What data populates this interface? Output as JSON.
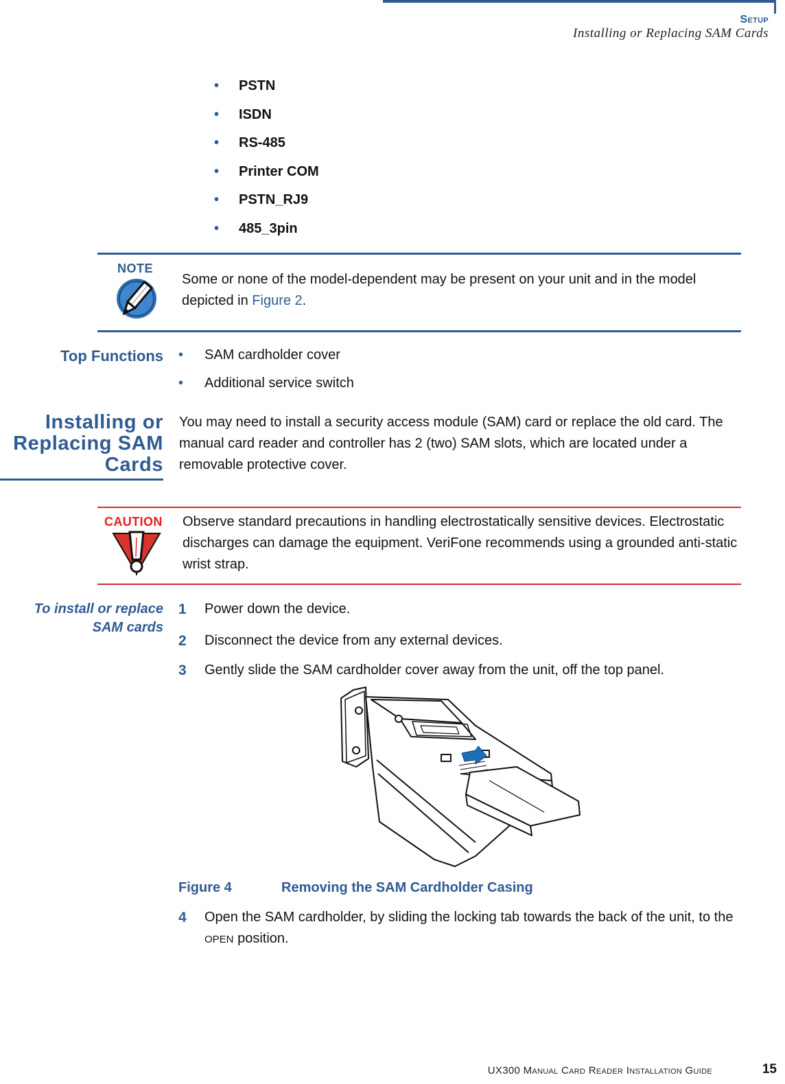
{
  "header": {
    "section": "Setup",
    "subtitle": "Installing or Replacing SAM Cards"
  },
  "connector_list": [
    "PSTN",
    "ISDN",
    "RS-485",
    "Printer COM",
    "PSTN_RJ9",
    "485_3pin"
  ],
  "note": {
    "label": "NOTE",
    "icon": "pencil-icon",
    "text_before": "Some or none of the model-dependent may be present on your unit and in the model depicted in ",
    "link": "Figure 2",
    "text_after": "."
  },
  "top_functions": {
    "heading": "Top Functions",
    "items": [
      "SAM cardholder cover",
      "Additional service switch"
    ]
  },
  "installing": {
    "heading_line1": "Installing or",
    "heading_line2": "Replacing SAM",
    "heading_line3": "Cards",
    "body": "You may need to install a security access module (SAM) card or replace the old card. The manual card reader and controller has 2 (two) SAM slots, which are located under a removable protective cover."
  },
  "caution": {
    "label": "CAUTION",
    "icon": "warning-exclamation-icon",
    "text": "Observe standard precautions in handling electrostatically sensitive devices. Electrostatic discharges can damage the equipment. VeriFone recommends using a grounded anti-static wrist strap."
  },
  "procedure": {
    "heading_line1": "To install or replace",
    "heading_line2": "SAM cards",
    "steps": [
      {
        "num": "1",
        "text": "Power down the device."
      },
      {
        "num": "2",
        "text": "Disconnect the device from any external devices."
      },
      {
        "num": "3",
        "text": "Gently slide the SAM cardholder cover away from the unit, off the top panel."
      },
      {
        "num": "4",
        "text_before": "Open the SAM cardholder, by sliding the locking tab towards the back of the unit, to the ",
        "smallcaps": "OPEN",
        "text_after": " position."
      }
    ]
  },
  "figure": {
    "number": "Figure 4",
    "caption": "Removing the SAM Cardholder Casing",
    "accent_color": "#1f6fb8"
  },
  "footer": {
    "guide_title": "UX300 Manual Card Reader Installation Guide",
    "page_number": "15"
  },
  "colors": {
    "brand_blue": "#2f5b93",
    "caution_red": "#e81d1d"
  }
}
